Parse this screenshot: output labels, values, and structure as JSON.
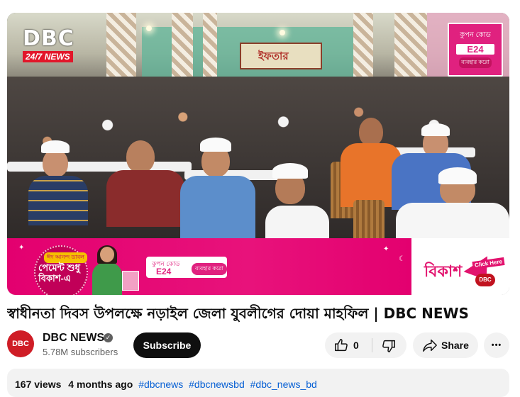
{
  "video": {
    "logo_main": "DBC",
    "logo_sub": "24/7 NEWS",
    "backdrop_banner_text": "ইফতার",
    "coupon_overlay": {
      "label": "কুপন কোড",
      "code": "E24",
      "button": "ব্যবহার করো"
    },
    "ad": {
      "eid_badge": "ঈদ আনন্দ ডাবল",
      "pay_text": "পেমেন্ট শুধু বিকাশ-এ",
      "coupon_label": "কুপন কোড",
      "coupon_code": "E24",
      "coupon_button": "ব্যবহার করো",
      "brand": "বিকাশ",
      "click_here": "Click Here",
      "mini_logo": "DBC"
    }
  },
  "title": "স্বাধীনতা দিবস উপলক্ষে নড়াইল জেলা যুবলীগের দোয়া মাহফিল | DBC NEWS",
  "channel": {
    "avatar_text": "DBC",
    "name": "DBC NEWS",
    "subscribers": "5.78M subscribers",
    "subscribe_label": "Subscribe"
  },
  "actions": {
    "like_count": "0",
    "share_label": "Share",
    "more_label": "•••"
  },
  "description": {
    "views": "167 views",
    "age": "4 months ago",
    "tags": [
      "#dbcnews",
      "#dbcnewsbd",
      "#dbc_news_bd"
    ]
  },
  "colors": {
    "brand_red": "#cf1d26",
    "bkash_pink": "#e2136e",
    "link_blue": "#065fd4",
    "chip_bg": "#f2f2f2"
  },
  "icons": [
    "like-icon",
    "dislike-icon",
    "share-icon",
    "more-icon",
    "verified-icon"
  ]
}
